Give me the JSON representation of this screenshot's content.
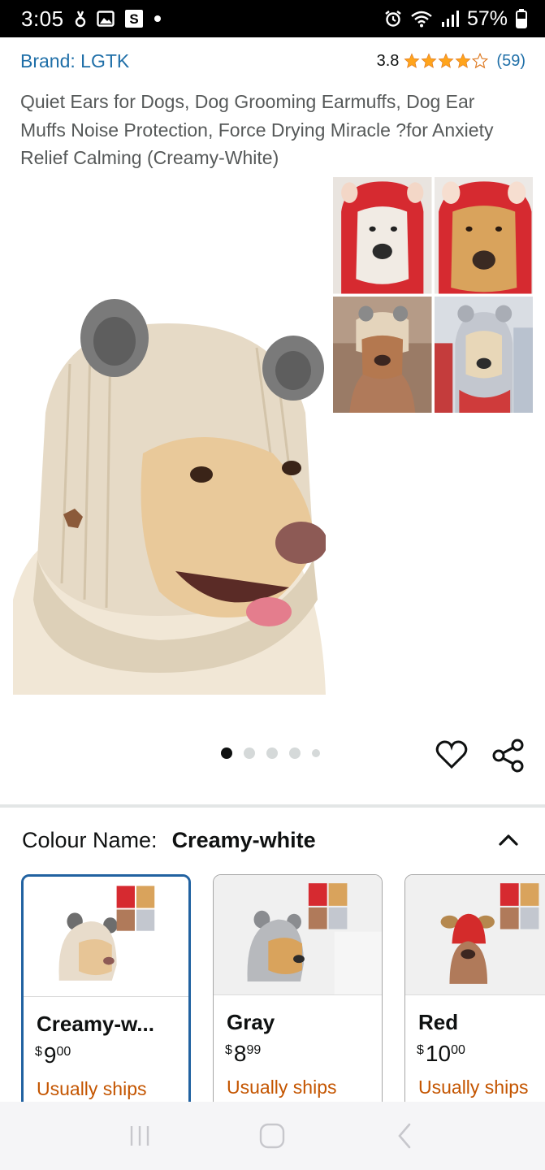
{
  "status_bar": {
    "time": "3:05",
    "notification_icons": [
      "gesture-icon",
      "gallery-icon",
      "s-app-icon",
      "dot-icon"
    ],
    "battery": "57%",
    "system_icons": [
      "alarm-icon",
      "wifi-icon",
      "signal-icon",
      "battery-icon"
    ]
  },
  "product": {
    "brand": "Brand: LGTK",
    "rating_value": "3.8",
    "rating_count": "(59)",
    "rating_stars": 3.8,
    "title": "Quiet Ears for Dogs, Dog Grooming Earmuffs, Dog Ear Muffs Noise Protection, Force Drying Miracle ?for Anxiety Relief Calming (Creamy-White)"
  },
  "carousel": {
    "total_images": 5,
    "active_index": 0
  },
  "variations": {
    "label": "Colour Name:",
    "selected": "Creamy-white",
    "options": [
      {
        "name": "Creamy-w...",
        "currency": "$",
        "whole": "9",
        "cents": "00",
        "shipping": "Usually ships",
        "hat_color": "#e8dccb",
        "ear_color": "#6d6d6d"
      },
      {
        "name": "Gray",
        "currency": "$",
        "whole": "8",
        "cents": "99",
        "shipping": "Usually ships",
        "hat_color": "#b7b9bd",
        "ear_color": "#8a8c90"
      },
      {
        "name": "Red",
        "currency": "$",
        "whole": "10",
        "cents": "00",
        "shipping": "Usually ships",
        "hat_color": "#d42b2b",
        "ear_color": "#b5884e"
      }
    ]
  },
  "colors": {
    "link": "#1f6fa8",
    "star": "#ffa41c",
    "shipping": "#c45500",
    "selected_border": "#2162a1"
  }
}
